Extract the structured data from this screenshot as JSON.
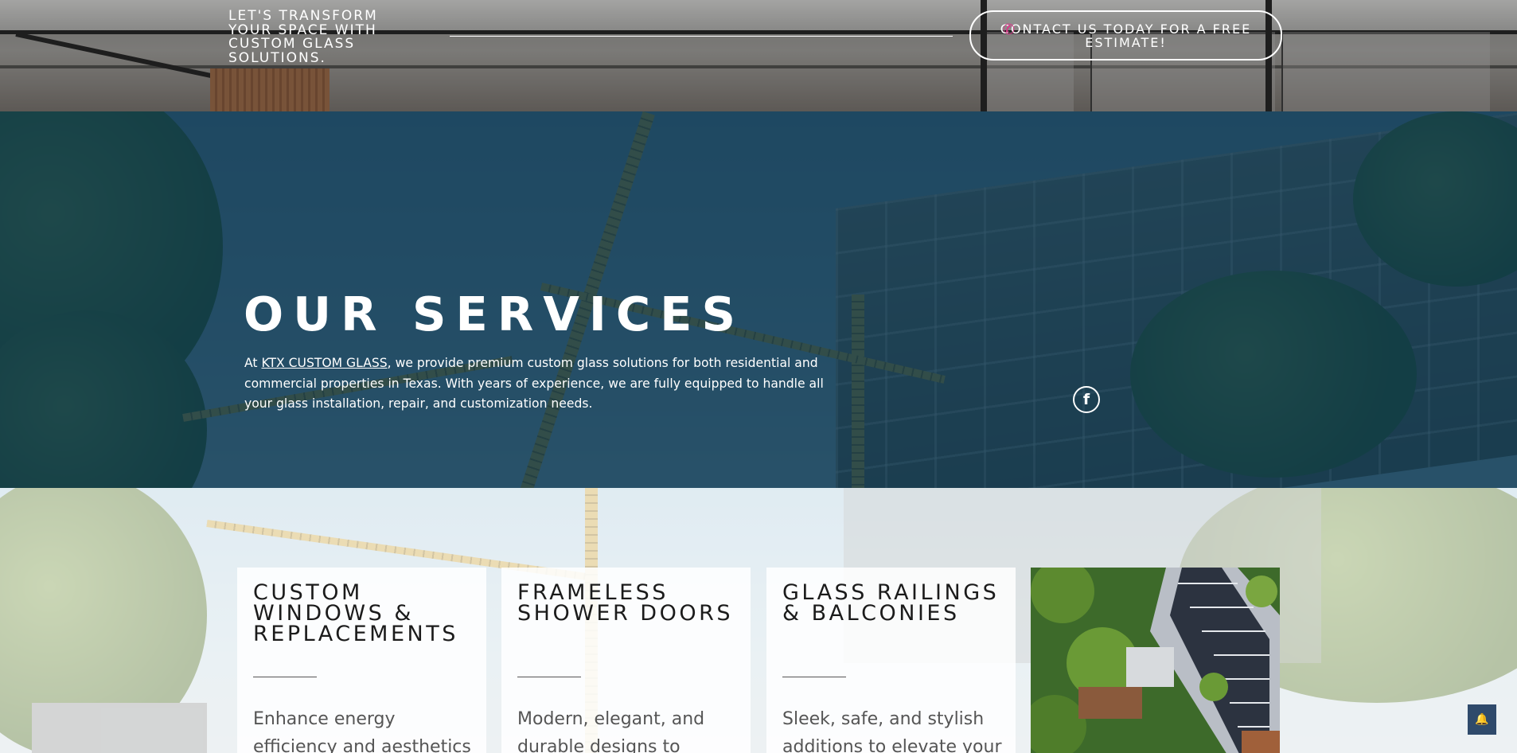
{
  "top_band": {
    "tagline": "LET'S TRANSFORM YOUR SPACE WITH CUSTOM GLASS SOLUTIONS.",
    "cta_button_label": "CONTACT US TODAY FOR A FREE ESTIMATE!",
    "cta_icon": "phone-icon"
  },
  "hero": {
    "title": "OUR SERVICES",
    "intro_prefix": "At ",
    "intro_link": "KTX CUSTOM GLASS",
    "intro_suffix": ", we provide premium custom glass solutions for both residential and commercial properties in Texas. With years of experience, we are fully equipped to handle all your glass installation, repair, and customization needs.",
    "social_icon": "facebook-icon",
    "social_glyph": "f"
  },
  "services": [
    {
      "title": "CUSTOM WINDOWS & REPLACEMENTS",
      "description": "Enhance energy efficiency and aesthetics with high-"
    },
    {
      "title": "FRAMELESS SHOWER DOORS",
      "description": "Modern, elegant, and durable designs to"
    },
    {
      "title": "GLASS RAILINGS & BALCONIES",
      "description": "Sleek, safe, and stylish additions to elevate your"
    }
  ],
  "photo_card_icon": "building-photo",
  "chat_widget": {
    "icon": "bell-icon",
    "glyph": "🔔"
  },
  "colors": {
    "hero_overlay": "#08344e",
    "cta_icon": "#e0338a",
    "text_light": "#ffffff",
    "card_text": "#555555",
    "chat_button": "#2f4a6b"
  }
}
